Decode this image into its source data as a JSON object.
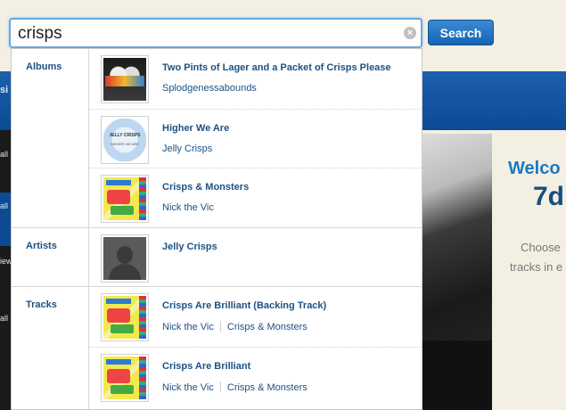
{
  "search": {
    "query": "crisps",
    "button_label": "Search"
  },
  "background": {
    "welcome_fragment": "Welco",
    "site_fragment": "7d",
    "choose_fragment": "Choose",
    "tracks_fragment": "tracks in e",
    "nav_fragment": "si",
    "left_fragments": [
      "all",
      "all",
      "iew",
      "all"
    ]
  },
  "results": {
    "albums": {
      "label": "Albums",
      "items": [
        {
          "title": "Two Pints of Lager and a Packet of Crisps Please",
          "artist": "Splodgenessabounds",
          "art": "splodge-cover"
        },
        {
          "title": "Higher We Are",
          "artist": "Jelly Crisps",
          "art": "jelly-cover",
          "art_text": "JELLY CRISPS",
          "art_text2": "HIGHER WE ARE"
        },
        {
          "title": "Crisps & Monsters",
          "artist": "Nick the Vic",
          "art": "nick-cover"
        }
      ]
    },
    "artists": {
      "label": "Artists",
      "items": [
        {
          "title": "Jelly Crisps",
          "art": "avatar-placeholder"
        }
      ]
    },
    "tracks": {
      "label": "Tracks",
      "items": [
        {
          "title": "Crisps Are Brilliant (Backing Track)",
          "artist": "Nick the Vic",
          "album": "Crisps & Monsters",
          "art": "nick-cover"
        },
        {
          "title": "Crisps Are Brilliant",
          "artist": "Nick the Vic",
          "album": "Crisps & Monsters",
          "art": "nick-cover"
        }
      ]
    }
  }
}
